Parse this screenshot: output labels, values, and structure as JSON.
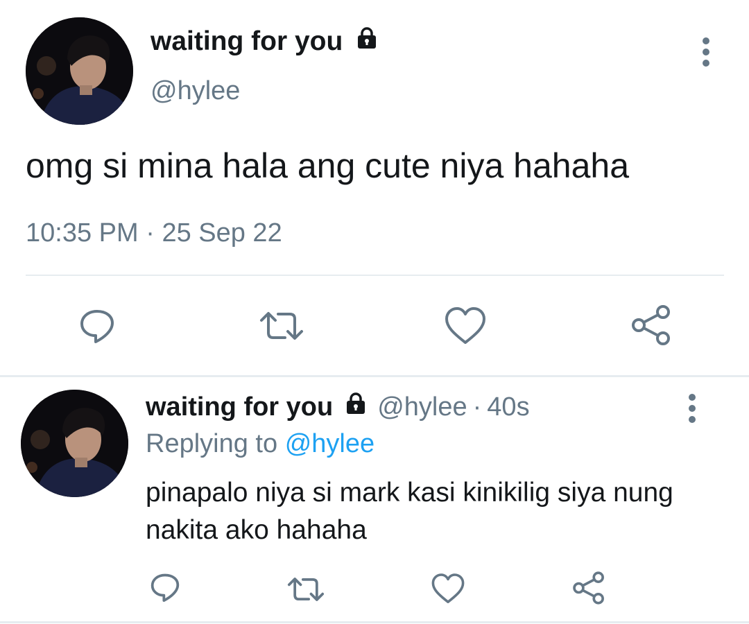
{
  "main_tweet": {
    "display_name": "waiting for you",
    "handle": "@hylee",
    "text": "omg si mina hala ang cute niya hahaha",
    "time": "10:35 PM",
    "separator": "·",
    "date": "25 Sep 22",
    "icons": [
      "lock-icon",
      "more-icon",
      "reply-icon",
      "retweet-icon",
      "like-icon",
      "share-icon"
    ]
  },
  "reply_tweet": {
    "display_name": "waiting for you",
    "handle": "@hylee",
    "separator": "·",
    "age": "40s",
    "replying_prefix": "Replying to",
    "replying_to": "@hylee",
    "text": "pinapalo niya si mark kasi kinikilig siya nung nakita ako hahaha"
  },
  "colors": {
    "text": "#14171a",
    "secondary": "#657786",
    "link": "#1da1f2",
    "divider": "#e6ecf0"
  }
}
